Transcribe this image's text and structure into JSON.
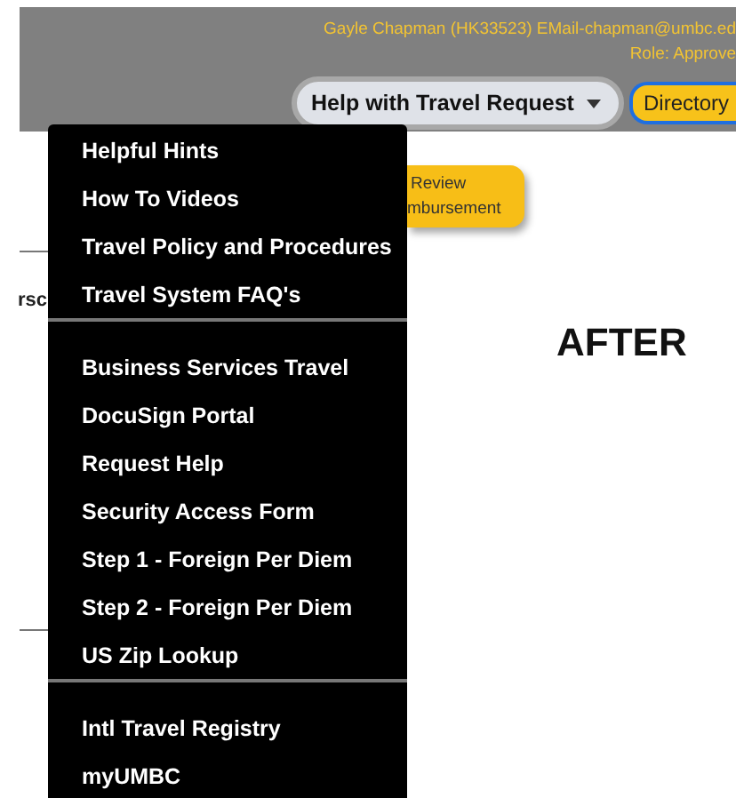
{
  "header": {
    "user_line": "Gayle Chapman (HK33523) EMail-chapman@umbc.ed",
    "role_line": "Role: Approve",
    "help_button": {
      "label": "Help with Travel Request",
      "expanded": true
    },
    "directory_button": "Directory"
  },
  "page": {
    "review_button": [
      "Review",
      "mbursement"
    ],
    "side_text": "rsc",
    "heading": "AFTER"
  },
  "help_menu": [
    [
      {
        "label": "Helpful Hints"
      },
      {
        "label": "How To Videos"
      },
      {
        "label": "Travel Policy and Procedures"
      },
      {
        "label": "Travel System FAQ's"
      }
    ],
    [
      {
        "label": "Business Services Travel"
      },
      {
        "label": "DocuSign Portal"
      },
      {
        "label": "Request Help"
      },
      {
        "label": "Security Access Form"
      },
      {
        "label": "Step 1 - Foreign Per Diem"
      },
      {
        "label": "Step 2 - Foreign Per Diem"
      },
      {
        "label": "US Zip Lookup"
      }
    ],
    [
      {
        "label": "Intl Travel Registry"
      },
      {
        "label": "myUMBC"
      }
    ]
  ]
}
